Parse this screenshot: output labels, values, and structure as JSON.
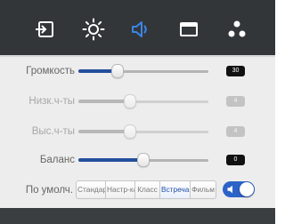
{
  "toolbar": {
    "icons": [
      "input-icon",
      "brightness-icon",
      "sound-icon",
      "picture-icon",
      "settings-icon"
    ],
    "active": "sound-icon",
    "colors": {
      "background": "#333638",
      "icon": "#ffffff",
      "active": "#3a86e8"
    }
  },
  "sliders": [
    {
      "label": "Громкость",
      "value": "30",
      "fraction": 0.3,
      "enabled": true
    },
    {
      "label": "Низк.ч-ты",
      "value": "4",
      "fraction": 0.4,
      "enabled": false
    },
    {
      "label": "Выс.ч-ты",
      "value": "4",
      "fraction": 0.4,
      "enabled": false
    },
    {
      "label": "Баланс",
      "value": "0",
      "fraction": 0.5,
      "enabled": true
    }
  ],
  "presets": {
    "label": "По умолч.",
    "options": [
      "Стандарт",
      "Настр-ка",
      "Класс",
      "Встреча",
      "Фильм"
    ],
    "selected": "Встреча"
  },
  "toggle": {
    "on": true,
    "icon": "speaker-icon"
  },
  "colors": {
    "accent": "#244f9c",
    "toggle": "#2c63c6"
  }
}
